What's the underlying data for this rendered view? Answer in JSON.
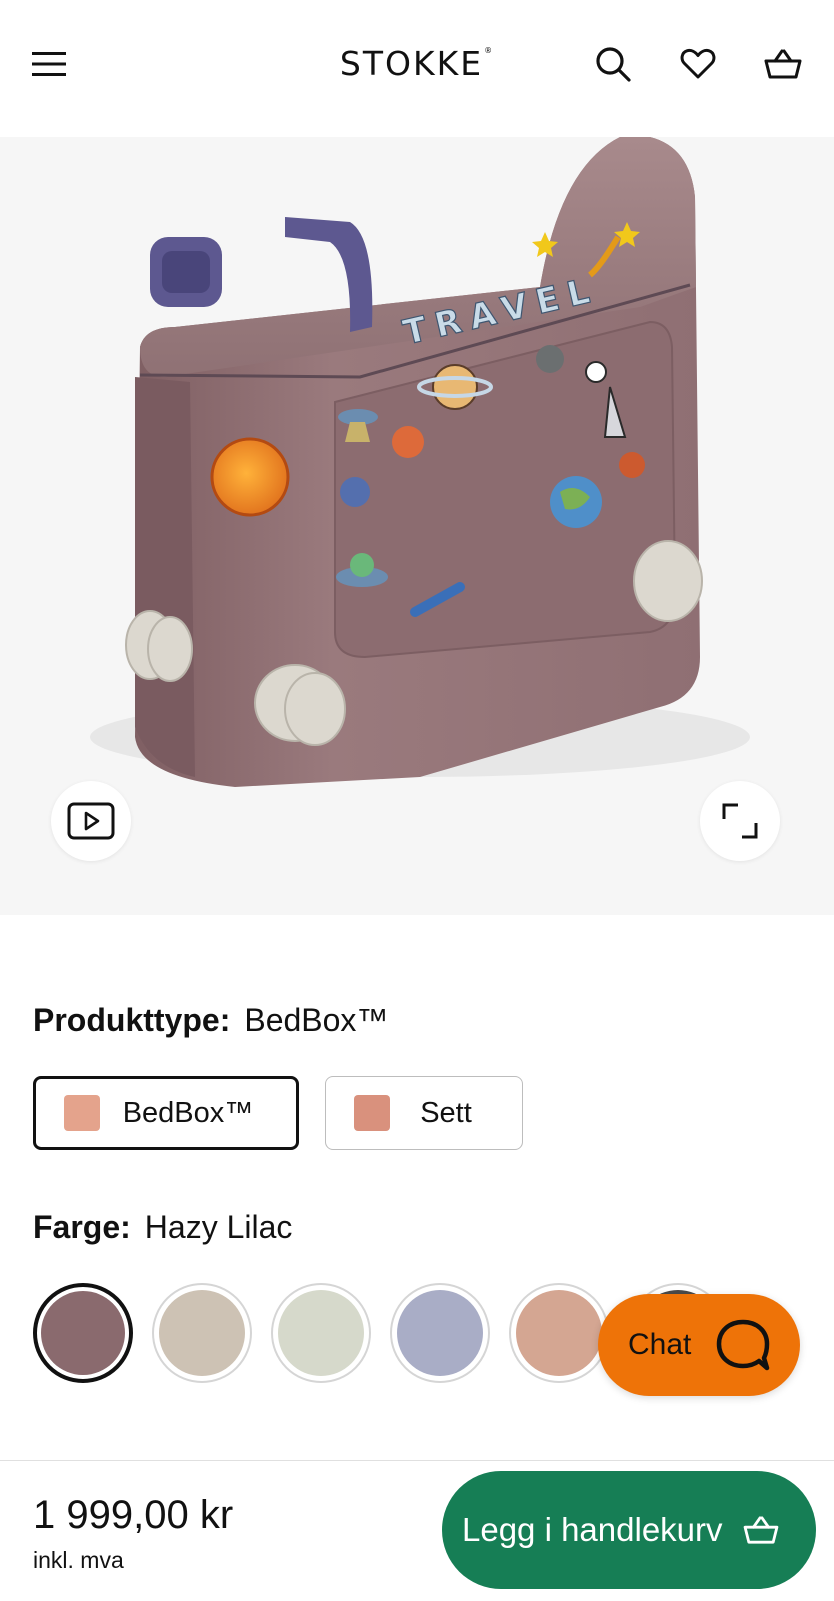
{
  "header": {
    "logo": "STOKKE",
    "logo_mark": "®",
    "icons": [
      "menu-icon",
      "search-icon",
      "heart-icon",
      "basket-icon"
    ]
  },
  "hero": {
    "product_sticker_text": "TRAVEL",
    "icons": [
      "play-video-icon",
      "expand-icon"
    ]
  },
  "product_type": {
    "label": "Produkttype:",
    "value": "BedBox™",
    "options": [
      {
        "label": "BedBox™",
        "selected": true
      },
      {
        "label": "Sett",
        "selected": false
      }
    ]
  },
  "color": {
    "label": "Farge:",
    "value": "Hazy Lilac",
    "swatches": [
      {
        "hex": "#8a6a6e",
        "selected": true
      },
      {
        "hex": "#cdc2b4",
        "selected": false
      },
      {
        "hex": "#d6d9cb",
        "selected": false
      },
      {
        "hex": "#a9adc6",
        "selected": false
      },
      {
        "hex": "#d4a692",
        "selected": false
      },
      {
        "hex": "#4a4a4a",
        "selected": false
      }
    ]
  },
  "chat": {
    "label": "Chat"
  },
  "bottom_bar": {
    "price": "1 999,00 kr",
    "vat_note": "inkl. mva",
    "add_to_cart": "Legg i handlekurv"
  },
  "colors": {
    "accent_green": "#167e55",
    "chat_orange": "#ee7308"
  }
}
